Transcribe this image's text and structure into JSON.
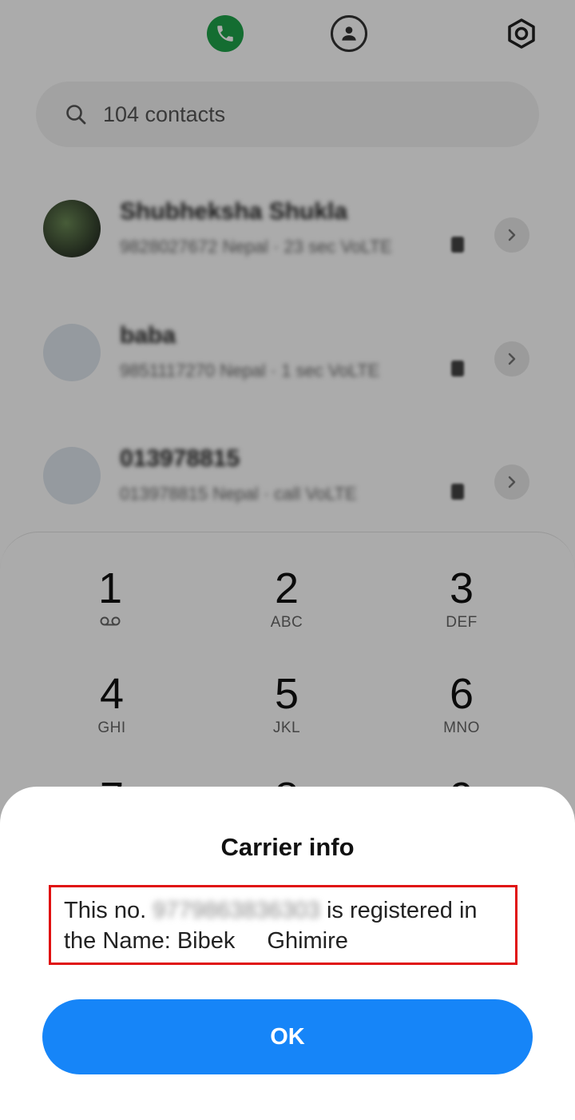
{
  "top_tabs": {
    "phone_icon": "phone-icon",
    "contacts_icon": "person-icon",
    "settings_icon": "settings-icon"
  },
  "search": {
    "placeholder": "104 contacts"
  },
  "contacts": [
    {
      "name": "Shubheksha Shukla",
      "detail": "9828027672 Nepal · 23 sec VoLTE"
    },
    {
      "name": "baba",
      "detail": "9851117270 Nepal · 1 sec VoLTE"
    },
    {
      "name": "013978815",
      "detail": "013978815 Nepal · call VoLTE"
    }
  ],
  "dialpad": {
    "keys": [
      {
        "digit": "1",
        "letters": ""
      },
      {
        "digit": "2",
        "letters": "ABC"
      },
      {
        "digit": "3",
        "letters": "DEF"
      },
      {
        "digit": "4",
        "letters": "GHI"
      },
      {
        "digit": "5",
        "letters": "JKL"
      },
      {
        "digit": "6",
        "letters": "MNO"
      },
      {
        "digit": "7",
        "letters": ""
      },
      {
        "digit": "8",
        "letters": ""
      },
      {
        "digit": "9",
        "letters": ""
      }
    ]
  },
  "dialog": {
    "title": "Carrier info",
    "message_prefix": "This no.",
    "masked_number": "9779863836303",
    "message_middle": "is registered in the Name: Bibek",
    "message_suffix": "Ghimire",
    "ok_label": "OK"
  },
  "colors": {
    "accent_blue": "#1685f8",
    "phone_green": "#1fa34a",
    "highlight_red": "#e01010"
  }
}
